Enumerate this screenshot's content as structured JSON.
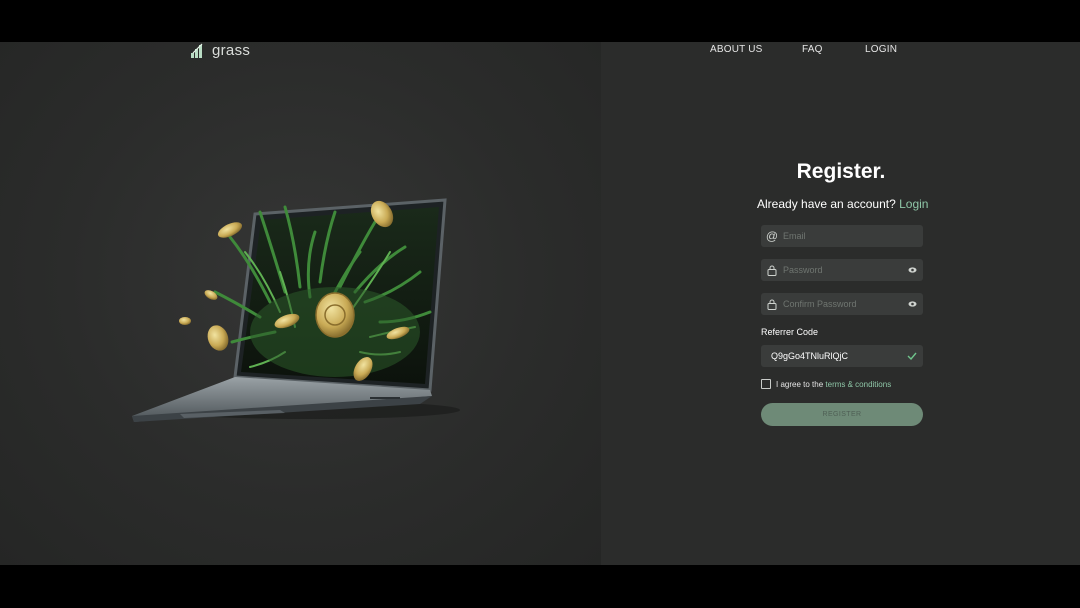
{
  "brand": {
    "name": "grass"
  },
  "nav": {
    "about": "ABOUT US",
    "faq": "FAQ",
    "login": "LOGIN"
  },
  "form": {
    "title": "Register.",
    "subtitle_prefix": "Already have an account?",
    "subtitle_link": "Login",
    "email_placeholder": "Email",
    "password_placeholder": "Password",
    "confirm_placeholder": "Confirm Password",
    "referrer_label": "Referrer Code",
    "referrer_value": "Q9gGo4TNluRlQjC",
    "agree_prefix": "I agree to the",
    "agree_link": "terms & conditions",
    "register_label": "REGISTER"
  },
  "colors": {
    "accent": "#8fc7a8",
    "button": "#6e8a77",
    "panel": "#2b2c2b"
  }
}
